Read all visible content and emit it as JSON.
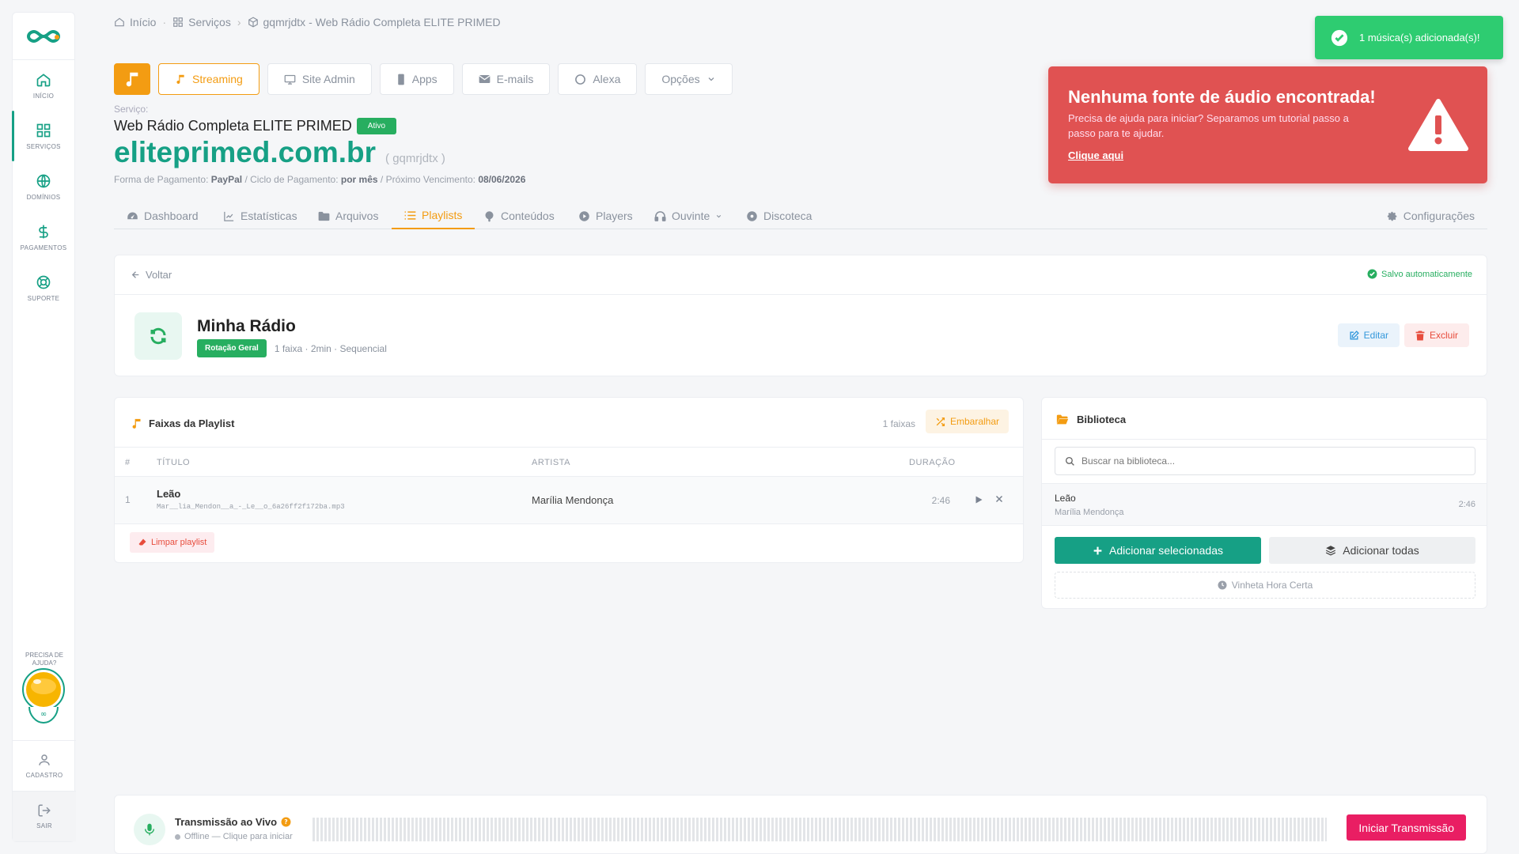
{
  "sidebar": {
    "items": [
      {
        "label": "INÍCIO",
        "icon": "home-icon"
      },
      {
        "label": "SERVIÇOS",
        "icon": "grid-icon"
      },
      {
        "label": "DOMÍNIOS",
        "icon": "globe-icon"
      },
      {
        "label": "PAGAMENTOS",
        "icon": "dollar-icon"
      },
      {
        "label": "SUPORTE",
        "icon": "lifebuoy-icon"
      }
    ],
    "help": "PRECISA DE AJUDA?",
    "cadastro": "CADASTRO",
    "sair": "SAIR"
  },
  "breadcrumb": {
    "home": "Início",
    "services": "Serviços",
    "current": "gqmrjdtx - Web Rádio Completa ELITE PRIMED"
  },
  "topnav": {
    "streaming": "Streaming",
    "site_admin": "Site Admin",
    "apps": "Apps",
    "emails": "E-mails",
    "alexa": "Alexa",
    "opcoes": "Opções"
  },
  "service": {
    "label": "Serviço:",
    "name": "Web Rádio Completa ELITE PRIMED",
    "status": "Ativo",
    "domain": "eliteprimed.com.br",
    "code": "( gqmrjdtx )",
    "payment_label": "Forma de Pagamento:",
    "payment": "PayPal",
    "cycle_label": "/ Ciclo de Pagamento:",
    "cycle": "por mês",
    "due_label": "/ Próximo Vencimento:",
    "due": "08/06/2026"
  },
  "tabs": [
    "Dashboard",
    "Estatísticas",
    "Arquivos",
    "Playlists",
    "Conteúdos",
    "Players",
    "Ouvinte",
    "Discoteca",
    "Configurações"
  ],
  "playlist": {
    "back": "Voltar",
    "saved": "Salvo automaticamente",
    "name": "Minha Rádio",
    "rotation": "Rotação Geral",
    "meta": "1 faixa · 2min · Sequencial",
    "edit": "Editar",
    "delete": "Excluir"
  },
  "tracks": {
    "title": "Faixas da Playlist",
    "count": "1 faixas",
    "shuffle": "Embaralhar",
    "headers": {
      "num": "#",
      "title": "TÍTULO",
      "artist": "ARTISTA",
      "duration": "DURAÇÃO"
    },
    "rows": [
      {
        "num": "1",
        "title": "Leão",
        "file": "Mar__lia_Mendon__a_-_Le__o_6a26ff2f172ba.mp3",
        "artist": "Marília Mendonça",
        "duration": "2:46"
      }
    ],
    "clear": "Limpar playlist"
  },
  "library": {
    "title": "Biblioteca",
    "search_placeholder": "Buscar na biblioteca...",
    "items": [
      {
        "title": "Leão",
        "artist": "Marília Mendonça",
        "duration": "2:46"
      }
    ],
    "add_selected": "Adicionar selecionadas",
    "add_all": "Adicionar todas",
    "vinheta": "Vinheta Hora Certa"
  },
  "live": {
    "title": "Transmissão ao Vivo",
    "status": "Offline — Clique para iniciar",
    "button": "Iniciar Transmissão"
  },
  "alert": {
    "title": "Nenhuma fonte de áudio encontrada!",
    "body": "Precisa de ajuda para iniciar? Separamos um tutorial passo a passo para te ajudar.",
    "link": "Clique aqui"
  },
  "toast": {
    "message": "1 música(s) adicionada(s)!"
  },
  "colors": {
    "accent": "#16a085",
    "orange": "#f39c12",
    "red": "#e05252",
    "success": "#2ecc71",
    "pink": "#e91e63"
  }
}
